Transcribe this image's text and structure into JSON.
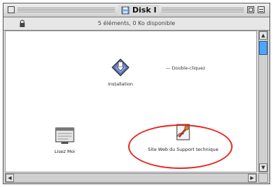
{
  "window": {
    "title": "Disk I",
    "info": "5 éléments, 0 Ko disponible"
  },
  "icons": [
    {
      "label": "Installation",
      "icon": "installer-icon"
    },
    {
      "label": "Lisez Moi",
      "icon": "document-icon"
    },
    {
      "label": "Site Web du Support technique",
      "icon": "web-link-icon"
    }
  ],
  "alias_label": "— Double-cliquez",
  "colors": {
    "highlight_circle": "#e8261f",
    "scroll_thumb": "#4fa4ff"
  }
}
